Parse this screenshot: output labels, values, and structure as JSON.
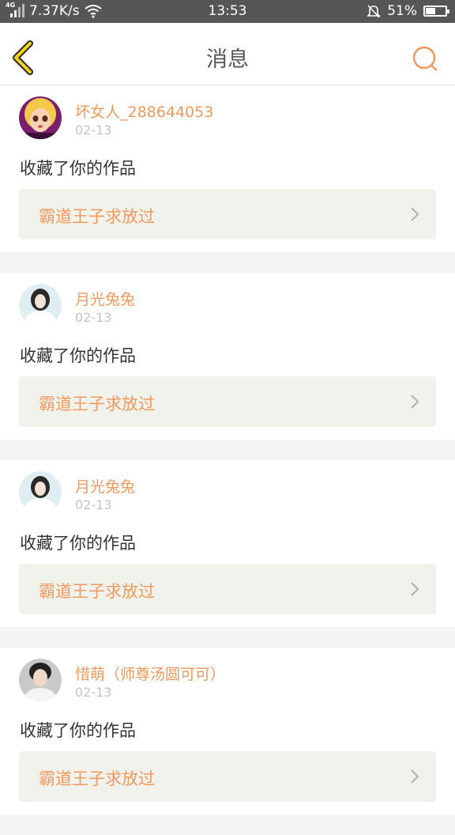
{
  "status_bar": {
    "network": "4G",
    "speed": "7.37K/s",
    "time": "13:53",
    "battery": "51%",
    "battery_level": 0.51
  },
  "header": {
    "title": "消息",
    "accent_color": "#f2995e"
  },
  "messages": [
    {
      "username": "坏女人_288644053",
      "date": "02-13",
      "action": "收藏了你的作品",
      "work_title": "霸道王子求放过",
      "avatar": "avatar-doll-blonde"
    },
    {
      "username": "月光兔兔",
      "date": "02-13",
      "action": "收藏了你的作品",
      "work_title": "霸道王子求放过",
      "avatar": "avatar-girl-white"
    },
    {
      "username": "月光兔兔",
      "date": "02-13",
      "action": "收藏了你的作品",
      "work_title": "霸道王子求放过",
      "avatar": "avatar-girl-white"
    },
    {
      "username": "惜萌（师尊汤圆可可）",
      "date": "02-13",
      "action": "收藏了你的作品",
      "work_title": "霸道王子求放过",
      "avatar": "avatar-boy"
    }
  ]
}
